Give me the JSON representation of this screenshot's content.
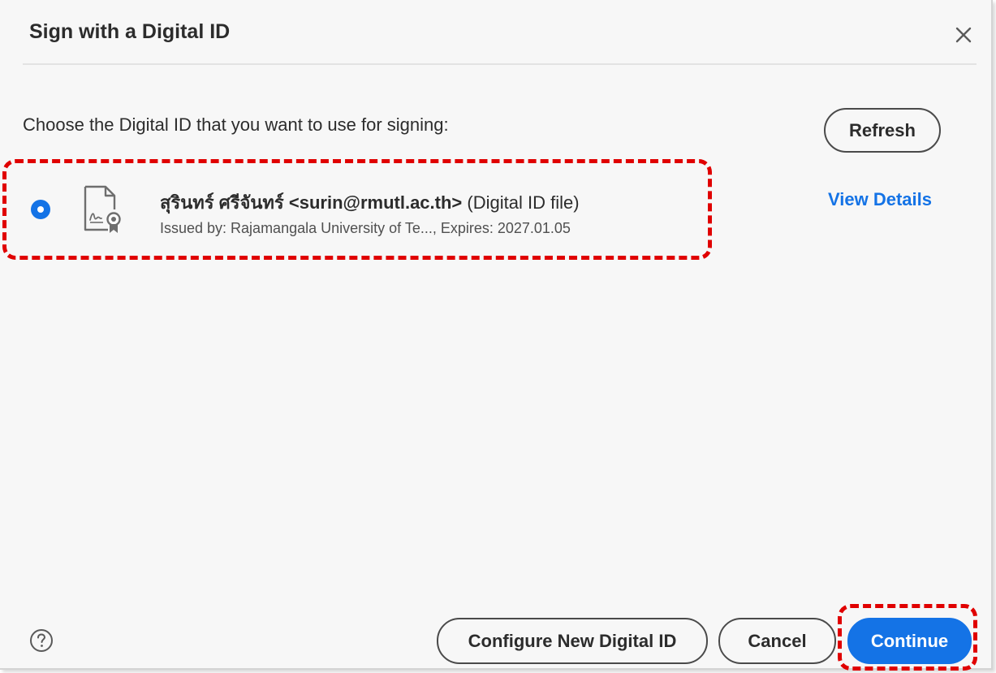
{
  "dialog": {
    "title": "Sign with a Digital ID",
    "prompt": "Choose the Digital ID that you want to use for signing:",
    "refresh_label": "Refresh"
  },
  "digital_id": {
    "name": "สุรินทร์ ศรีจันทร์",
    "email": "<surin@rmutl.ac.th>",
    "type": "(Digital ID file)",
    "issuer_line": "Issued by: Rajamangala University of Te..., Expires: 2027.01.05",
    "view_details_label": "View Details",
    "selected": true
  },
  "footer": {
    "configure_label": "Configure New Digital ID",
    "cancel_label": "Cancel",
    "continue_label": "Continue"
  },
  "icons": {
    "close": "close-icon",
    "certificate": "certificate-file-icon",
    "help": "help-icon"
  },
  "colors": {
    "accent": "#1473e6",
    "annotation": "#e00000",
    "background": "#f7f7f7"
  }
}
